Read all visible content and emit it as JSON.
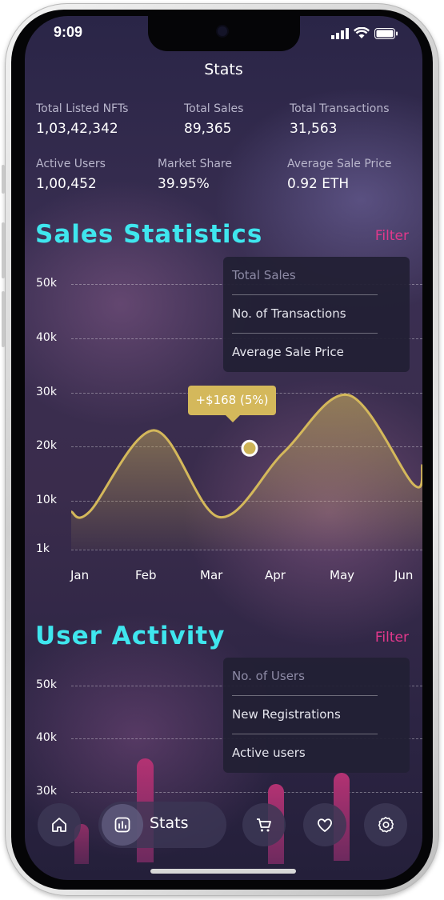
{
  "status_bar": {
    "time": "9:09"
  },
  "header": {
    "title": "Stats"
  },
  "stats": [
    {
      "label": "Total Listed NFTs",
      "value": "1,03,42,342"
    },
    {
      "label": "Total Sales",
      "value": "89,365"
    },
    {
      "label": "Total Transactions",
      "value": "31,563"
    },
    {
      "label": "Active Users",
      "value": "1,00,452"
    },
    {
      "label": "Market Share",
      "value": "39.95%"
    },
    {
      "label": "Average Sale Price",
      "value": "0.92 ETH"
    }
  ],
  "sales": {
    "title": "Sales Statistics",
    "filter_label": "Filter",
    "filter_options": [
      "Total Sales",
      "No. of Transactions",
      "Average Sale Price"
    ],
    "selected_option": "Total Sales",
    "tooltip": "+$168 (5%)"
  },
  "activity": {
    "title": "User Activity",
    "filter_label": "Filter",
    "filter_options": [
      "No. of Users",
      "New Registrations",
      "Active users"
    ],
    "selected_option": "No. of Users",
    "y_ticks": [
      "50k",
      "40k",
      "30k"
    ]
  },
  "nav": {
    "active_label": "Stats",
    "icons": [
      "home-icon",
      "stats-icon",
      "cart-icon",
      "heart-icon",
      "settings-icon"
    ]
  },
  "colors": {
    "accent_cyan": "#3fe6ee",
    "filter_pink": "#e2388c",
    "line_gold": "#d4b85b"
  },
  "chart_data": {
    "type": "area",
    "title": "Sales Statistics",
    "categories": [
      "Jan",
      "Feb",
      "Mar",
      "Apr",
      "May",
      "Jun"
    ],
    "x": [
      "Jan",
      "Feb",
      "Mar",
      "Apr",
      "May",
      "Jun"
    ],
    "series": [
      {
        "values": [
          8000,
          23000,
          7000,
          19000,
          29500,
          13000
        ]
      }
    ],
    "y_ticks": [
      "1k",
      "10k",
      "20k",
      "30k",
      "40k",
      "50k"
    ],
    "highlight": {
      "x": "Apr",
      "y": 20000,
      "label": "+$168 (5%)"
    },
    "ylim": [
      1000,
      50000
    ],
    "grid": true
  }
}
